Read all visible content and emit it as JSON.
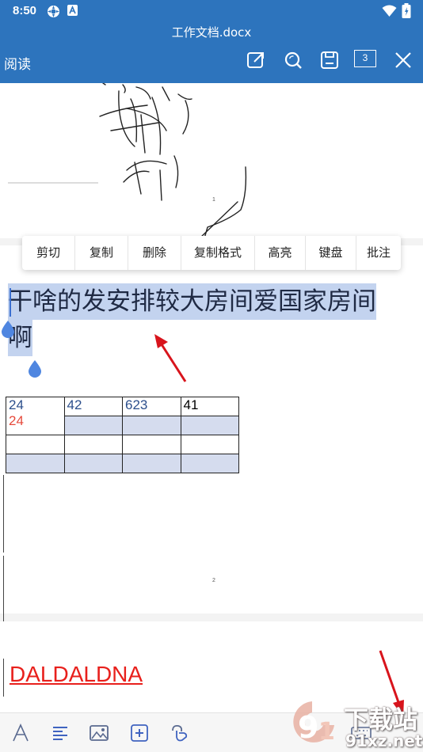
{
  "status_bar": {
    "time": "8:50"
  },
  "header": {
    "title": "工作文档.docx",
    "mode_label": "阅读",
    "page_count": "3"
  },
  "context_menu": {
    "items": [
      "剪切",
      "复制",
      "删除",
      "复制格式",
      "高亮",
      "键盘",
      "批注"
    ]
  },
  "document": {
    "selected_text_line1": "干啥的发安排较大房间爱国家房间",
    "selected_text_line2": "啊",
    "page_number_1": "1",
    "page_number_2": "2",
    "table": {
      "rows": [
        [
          "24",
          "42",
          "623",
          "41"
        ],
        [
          "24",
          "",
          "",
          ""
        ],
        [
          "",
          "",
          "",
          ""
        ],
        [
          "",
          "",
          "",
          ""
        ]
      ]
    },
    "red_text": "DALDALDNA"
  },
  "watermark": {
    "logo_text": "下载站",
    "site": "91xz.net"
  },
  "colors": {
    "header": "#2d74bd",
    "selection": "#c3d3ef",
    "handle": "#4f86e0",
    "red_text": "#e8201c",
    "arrow": "#d8141c"
  },
  "icons": {
    "status": [
      "cast-icon",
      "a-icon",
      "wifi-icon",
      "battery-icon"
    ],
    "toolbar": [
      "edit-export-icon",
      "search-icon",
      "save-icon",
      "close-icon"
    ],
    "bottom": [
      "font-icon",
      "paragraph-icon",
      "image-icon",
      "insert-icon",
      "link-icon",
      "keyboard-icon"
    ]
  }
}
